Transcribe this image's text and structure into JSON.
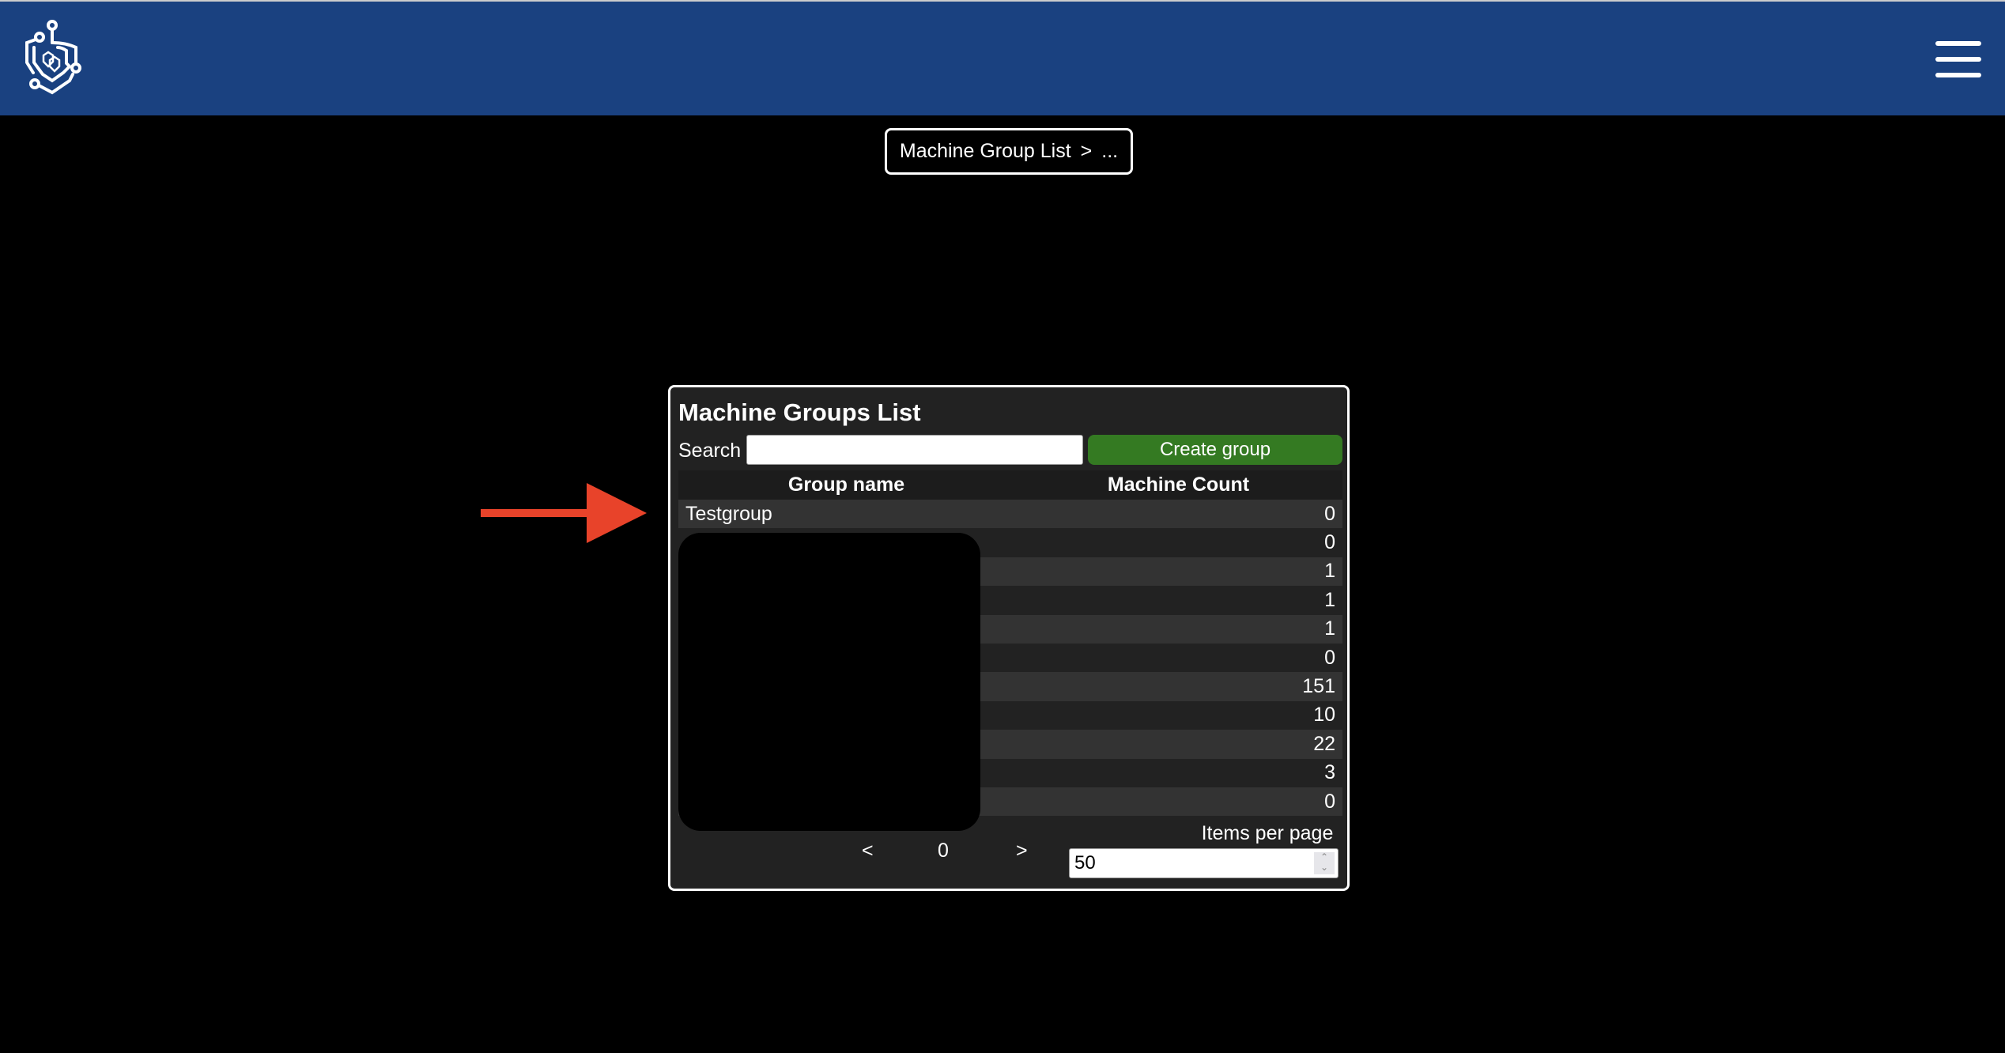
{
  "header": {
    "logo_icon": "shield-circuit-logo",
    "menu_icon": "hamburger-menu-icon",
    "background": "#1a4180"
  },
  "breadcrumb": {
    "item": "Machine Group List",
    "separator": ">",
    "current": "..."
  },
  "panel": {
    "title": "Machine Groups List",
    "search_label": "Search",
    "search_value": "",
    "create_button": "Create group",
    "create_button_color": "#347a22",
    "columns": [
      "Group name",
      "Machine Count"
    ],
    "rows": [
      {
        "name": "Testgroup",
        "count": "0"
      },
      {
        "count": "0"
      },
      {
        "count": "1"
      },
      {
        "count": "1"
      },
      {
        "count": "1"
      },
      {
        "count": "0"
      },
      {
        "count": "151"
      },
      {
        "count": "10"
      },
      {
        "count": "22"
      },
      {
        "count": "3"
      },
      {
        "count": "0"
      }
    ],
    "pagination": {
      "prev": "<",
      "page": "0",
      "next": ">"
    },
    "items_per_page_label": "Items per page",
    "items_per_page_value": "50"
  },
  "annotation": {
    "arrow_color": "#e8432a"
  }
}
